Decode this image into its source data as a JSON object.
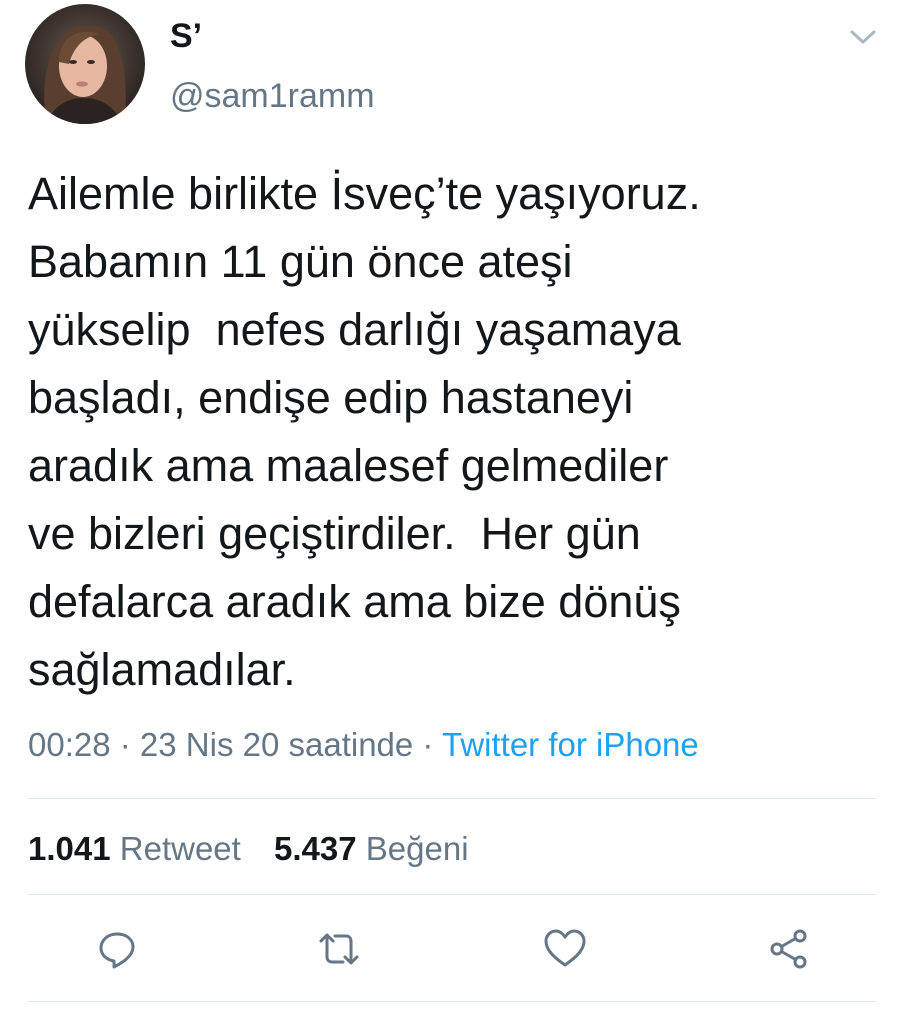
{
  "tweet": {
    "display_name": "S’",
    "handle": "@sam1ramm",
    "text": "Ailemle birlikte İsveç’te yaşıyoruz.\nBabamın 11 gün önce ateşi\nyükselip  nefes darlığı yaşamaya\nbaşladı, endişe edip hastaneyi\naradık ama maalesef gelmediler\nve bizleri geçiştirdiler.  Her gün\ndefalarca aradık ama bize dönüş\nsağlamadılar.",
    "timestamp": "00:28 · 23 Nis 20 saatinde · ",
    "source": "Twitter for iPhone",
    "stats": {
      "retweet_count": "1.041",
      "retweet_label": "Retweet",
      "like_count": "5.437",
      "like_label": "Beğeni"
    }
  },
  "icons": {
    "caret": "chevron-down-icon",
    "reply": "reply-icon",
    "retweet": "retweet-icon",
    "like": "heart-icon",
    "share": "share-icon"
  },
  "colors": {
    "text": "#14171a",
    "secondary": "#657786",
    "link": "#1da1f2",
    "divider": "#e1e8ed"
  }
}
